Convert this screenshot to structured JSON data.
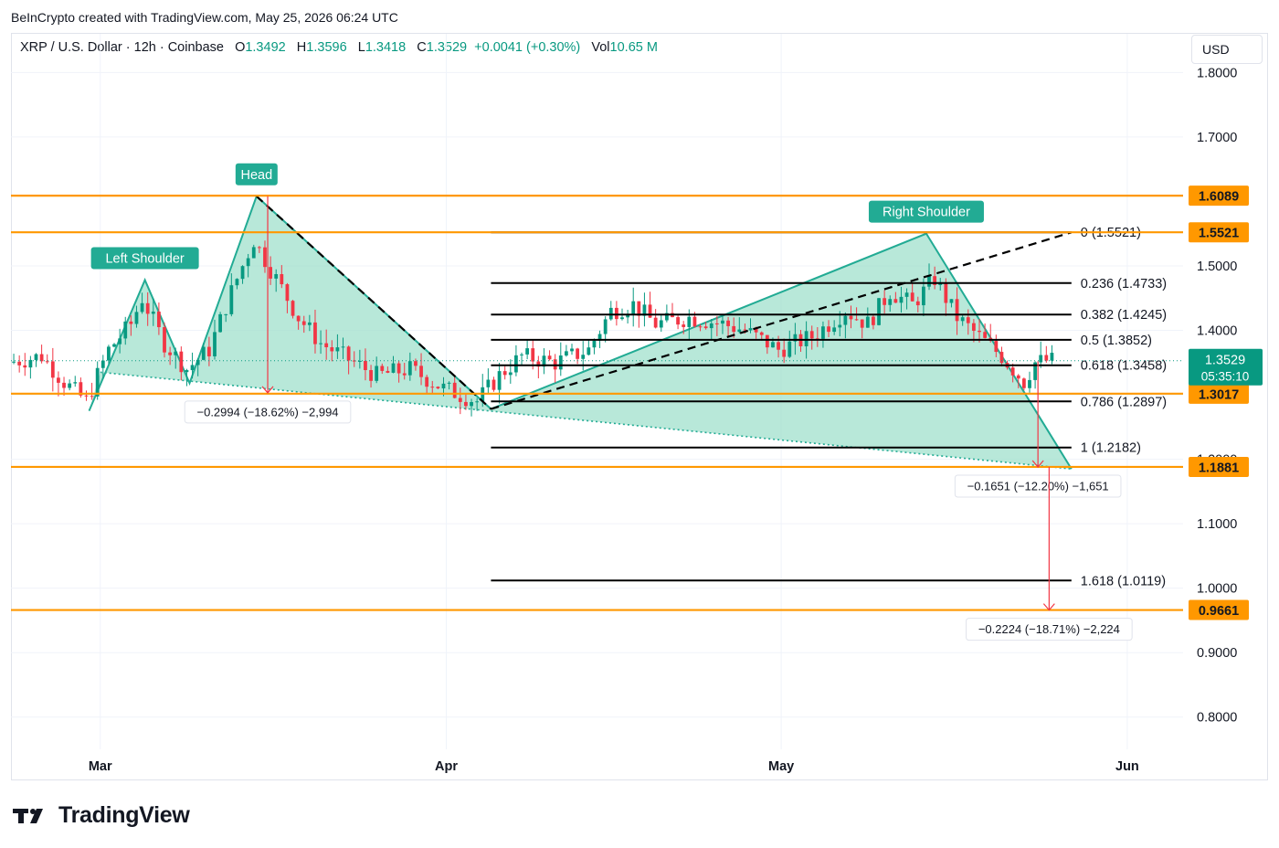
{
  "credit": "BeInCrypto created with TradingView.com, May 25, 2026 06:24 UTC",
  "legend": {
    "symbol": "XRP / U.S. Dollar · 12h · Coinbase",
    "o_label": "O",
    "o": "1.3492",
    "h_label": "H",
    "h": "1.3596",
    "l_label": "L",
    "l": "1.3418",
    "c_label": "C",
    "c": "1.3529",
    "change": "+0.0041 (+0.30%)",
    "vol_label": "Vol",
    "vol": "10.65 M"
  },
  "currency": "USD",
  "brand": "TradingView",
  "colors": {
    "up": "#089981",
    "down": "#f23645",
    "support": "#ff9800",
    "pattern_fill": "#9ddfcb",
    "pattern_stroke": "#22ab94",
    "measure": "#f23645"
  },
  "chart_data": {
    "type": "candlestick",
    "x_axis": {
      "ticks": [
        {
          "label": "Mar",
          "date": "2026-03-01"
        },
        {
          "label": "Apr",
          "date": "2026-04-01"
        },
        {
          "label": "May",
          "date": "2026-05-01"
        },
        {
          "label": "Jun",
          "date": "2026-06-01"
        }
      ],
      "range": [
        "2026-02-21",
        "2026-06-06"
      ]
    },
    "y_axis": {
      "range": [
        0.75,
        1.86
      ],
      "ticks": [
        "1.8000",
        "1.7000",
        "1.5000",
        "1.4000",
        "1.3000",
        "1.2000",
        "1.1000",
        "1.0000",
        "0.9000",
        "0.8000"
      ],
      "grid": true
    },
    "price_path": [
      [
        "2026-02-21",
        1.35
      ],
      [
        "2026-02-24",
        1.36
      ],
      [
        "2026-02-26",
        1.32
      ],
      [
        "2026-02-28",
        1.29
      ],
      [
        "2026-03-02",
        1.37
      ],
      [
        "2026-03-04",
        1.41
      ],
      [
        "2026-03-05",
        1.45
      ],
      [
        "2026-03-07",
        1.38
      ],
      [
        "2026-03-09",
        1.34
      ],
      [
        "2026-03-11",
        1.37
      ],
      [
        "2026-03-13",
        1.46
      ],
      [
        "2026-03-15",
        1.54
      ],
      [
        "2026-03-17",
        1.48
      ],
      [
        "2026-03-19",
        1.42
      ],
      [
        "2026-03-21",
        1.38
      ],
      [
        "2026-03-23",
        1.36
      ],
      [
        "2026-03-26",
        1.33
      ],
      [
        "2026-03-29",
        1.34
      ],
      [
        "2026-04-01",
        1.31
      ],
      [
        "2026-04-04",
        1.29
      ],
      [
        "2026-04-06",
        1.33
      ],
      [
        "2026-04-08",
        1.36
      ],
      [
        "2026-04-11",
        1.35
      ],
      [
        "2026-04-14",
        1.37
      ],
      [
        "2026-04-16",
        1.43
      ],
      [
        "2026-04-18",
        1.44
      ],
      [
        "2026-04-20",
        1.41
      ],
      [
        "2026-04-23",
        1.42
      ],
      [
        "2026-04-26",
        1.41
      ],
      [
        "2026-04-28",
        1.4
      ],
      [
        "2026-05-01",
        1.37
      ],
      [
        "2026-05-04",
        1.39
      ],
      [
        "2026-05-07",
        1.43
      ],
      [
        "2026-05-09",
        1.41
      ],
      [
        "2026-05-11",
        1.46
      ],
      [
        "2026-05-13",
        1.44
      ],
      [
        "2026-05-15",
        1.48
      ],
      [
        "2026-05-17",
        1.42
      ],
      [
        "2026-05-19",
        1.39
      ],
      [
        "2026-05-21",
        1.36
      ],
      [
        "2026-05-23",
        1.32
      ],
      [
        "2026-05-24",
        1.35
      ],
      [
        "2026-05-25",
        1.3529
      ]
    ],
    "horizontal_levels": [
      {
        "price": 1.6089,
        "label": "1.6089"
      },
      {
        "price": 1.5521,
        "label": "1.5521"
      },
      {
        "price": 1.3017,
        "label": "1.3017"
      },
      {
        "price": 1.1881,
        "label": "1.1881"
      },
      {
        "price": 0.9661,
        "label": "0.9661"
      }
    ],
    "fibonacci": {
      "start_date": "2026-04-05",
      "end_date": "2026-05-27",
      "levels": [
        {
          "ratio": "0",
          "price": 1.5521,
          "label": "0 (1.5521)"
        },
        {
          "ratio": "0.236",
          "price": 1.4733,
          "label": "0.236 (1.4733)"
        },
        {
          "ratio": "0.382",
          "price": 1.4245,
          "label": "0.382 (1.4245)"
        },
        {
          "ratio": "0.5",
          "price": 1.3852,
          "label": "0.5 (1.3852)"
        },
        {
          "ratio": "0.618",
          "price": 1.3458,
          "label": "0.618 (1.3458)"
        },
        {
          "ratio": "0.786",
          "price": 1.2897,
          "label": "0.786 (1.2897)"
        },
        {
          "ratio": "1",
          "price": 1.2182,
          "label": "1 (1.2182)"
        },
        {
          "ratio": "1.618",
          "price": 1.0119,
          "label": "1.618 (1.0119)"
        }
      ]
    },
    "pattern": {
      "points": [
        {
          "date": "2026-02-28",
          "price": 1.275
        },
        {
          "date": "2026-03-05",
          "price": 1.478,
          "label": "Left Shoulder"
        },
        {
          "date": "2026-03-09",
          "price": 1.318
        },
        {
          "date": "2026-03-15",
          "price": 1.608,
          "label": "Head"
        },
        {
          "date": "2026-04-05",
          "price": 1.278
        },
        {
          "date": "2026-05-14",
          "price": 1.55,
          "label": "Right Shoulder"
        },
        {
          "date": "2026-05-27",
          "price": 1.185
        }
      ],
      "neckline": [
        {
          "date": "2026-03-01",
          "price": 1.335
        },
        {
          "date": "2026-05-27",
          "price": 1.185
        }
      ]
    },
    "trend_lines": [
      {
        "from": {
          "date": "2026-03-15",
          "price": 1.608
        },
        "to": {
          "date": "2026-04-05",
          "price": 1.278
        },
        "style": "dashed"
      },
      {
        "from": {
          "date": "2026-04-05",
          "price": 1.278
        },
        "to": {
          "date": "2026-05-27",
          "price": 1.552
        },
        "style": "dashed"
      }
    ],
    "measurements": [
      {
        "date": "2026-03-16",
        "from": 1.608,
        "to": 1.303,
        "label": "−0.2994 (−18.62%) −2,994"
      },
      {
        "date": "2026-05-24",
        "from": 1.352,
        "to": 1.188,
        "label": "−0.1651 (−12.20%) −1,651"
      },
      {
        "date": "2026-05-25",
        "from": 1.188,
        "to": 0.966,
        "label": "−0.2224 (−18.71%) −2,224"
      }
    ],
    "current_price": {
      "price": 1.3529,
      "label": "1.3529",
      "countdown": "05:35:10"
    }
  }
}
